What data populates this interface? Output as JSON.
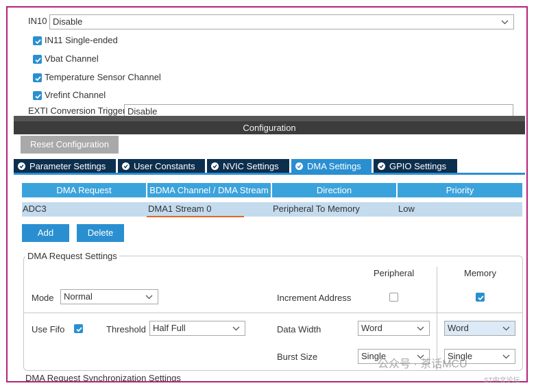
{
  "top": {
    "in10_label": "IN10",
    "in10_value": "Disable",
    "checks": [
      {
        "label": "IN11 Single-ended",
        "checked": true
      },
      {
        "label": "Vbat Channel",
        "checked": true
      },
      {
        "label": "Temperature Sensor Channel",
        "checked": true
      },
      {
        "label": "Vrefint Channel",
        "checked": true
      }
    ],
    "cut_label": "EXTI Conversion Trigger",
    "cut_value": "Disable"
  },
  "config": {
    "title": "Configuration",
    "reset_label": "Reset Configuration",
    "tabs": [
      {
        "label": "Parameter Settings",
        "active": false
      },
      {
        "label": "User Constants",
        "active": false
      },
      {
        "label": "NVIC Settings",
        "active": false
      },
      {
        "label": "DMA Settings",
        "active": true
      },
      {
        "label": "GPIO Settings",
        "active": false
      }
    ]
  },
  "dma_table": {
    "headers": [
      "DMA Request",
      "BDMA Channel / DMA Stream",
      "Direction",
      "Priority"
    ],
    "rows": [
      [
        "ADC3",
        "DMA1 Stream 0",
        "Peripheral To Memory",
        "Low"
      ]
    ]
  },
  "actions": {
    "add_label": "Add",
    "delete_label": "Delete"
  },
  "request_settings": {
    "legend": "DMA Request Settings",
    "peripheral_header": "Peripheral",
    "memory_header": "Memory",
    "mode_label": "Mode",
    "mode_value": "Normal",
    "increment_label": "Increment Address",
    "peripheral_increment": false,
    "memory_increment": true,
    "use_fifo_label": "Use Fifo",
    "use_fifo": true,
    "threshold_label": "Threshold",
    "threshold_value": "Half Full",
    "data_width_label": "Data Width",
    "peripheral_width": "Word",
    "memory_width": "Word",
    "burst_label": "Burst Size",
    "peripheral_burst": "Single",
    "memory_burst": "Single"
  },
  "bottom_cut_label": "DMA Request Synchronization Settings",
  "watermark": {
    "text": "公众号 · 茶话MCU",
    "site": "ST中文论坛"
  },
  "colors": {
    "frame": "#b3237a",
    "accent": "#2a8fd1",
    "tab_dark": "#0d2f4e",
    "header": "#3ba3dc",
    "row_selected": "#c4dbee",
    "underline": "#e8641c"
  }
}
